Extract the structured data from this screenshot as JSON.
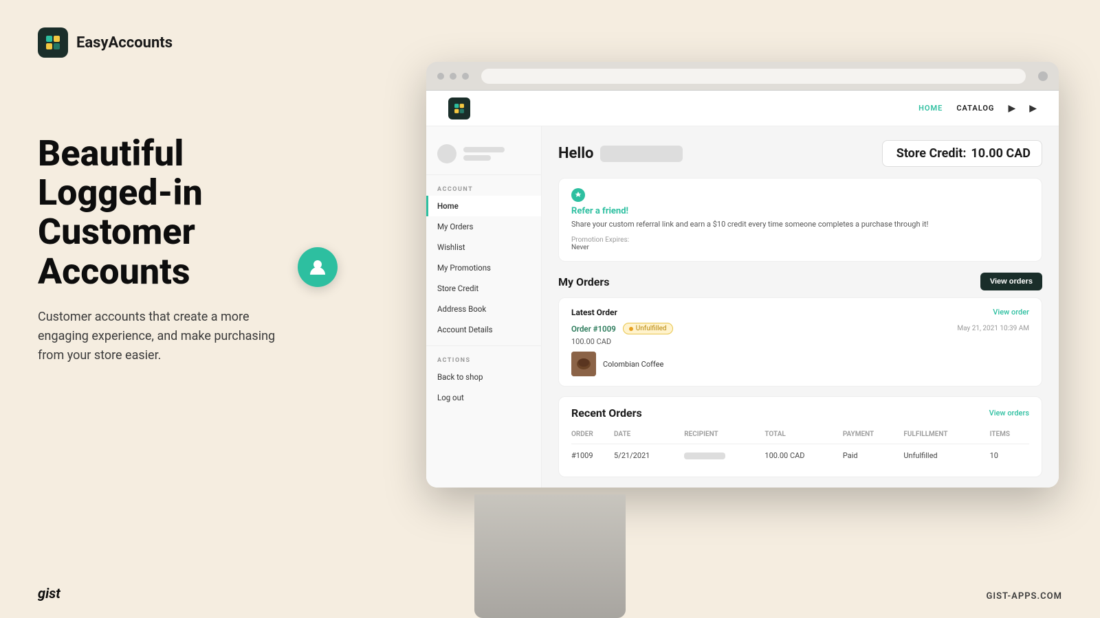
{
  "brand": {
    "name": "EasyAccounts",
    "logo_alt": "EasyAccounts logo icon"
  },
  "hero": {
    "title": "Beautiful\nLogged-in\nCustomer\nAccounts",
    "subtitle": "Customer accounts that create a more engaging experience, and make purchasing from your store easier."
  },
  "footer": {
    "left": "gist",
    "right": "GIST-APPS.COM"
  },
  "store": {
    "nav": {
      "items": [
        "HOME",
        "CATALOG"
      ],
      "icons": [
        "user-icon",
        "cart-icon"
      ]
    },
    "header": {
      "hello": "Hello",
      "store_credit_label": "Store Credit:",
      "store_credit_value": "10.00 CAD"
    },
    "sidebar": {
      "account_section": "ACCOUNT",
      "actions_section": "ACTIONS",
      "nav_items": [
        {
          "label": "Home",
          "active": true
        },
        {
          "label": "My Orders",
          "active": false
        },
        {
          "label": "Wishlist",
          "active": false
        },
        {
          "label": "My Promotions",
          "active": false
        },
        {
          "label": "Store Credit",
          "active": false
        },
        {
          "label": "Address Book",
          "active": false
        },
        {
          "label": "Account Details",
          "active": false
        }
      ],
      "action_items": [
        {
          "label": "Back to shop",
          "active": false
        },
        {
          "label": "Log out",
          "active": false
        }
      ]
    },
    "referral": {
      "title": "Refer a friend!",
      "description": "Share your custom referral link and earn a $10 credit every time someone completes a purchase through it!",
      "expires_label": "Promotion Expires:",
      "expires_value": "Never"
    },
    "my_orders": {
      "title": "My Orders",
      "view_orders_btn": "View orders",
      "latest_order": {
        "section_title": "Latest Order",
        "view_link": "View order",
        "order_number": "Order #1009",
        "status": "Unfulfilled",
        "date": "May 21, 2021 10:39 AM",
        "amount": "100.00 CAD",
        "product_name": "Colombian Coffee"
      },
      "recent_orders": {
        "title": "Recent Orders",
        "view_link": "View orders",
        "columns": [
          "ORDER",
          "DATE",
          "RECIPIENT",
          "TOTAL",
          "PAYMENT",
          "FULFILLMENT",
          "ITEMS"
        ],
        "rows": [
          {
            "order": "#1009",
            "date": "5/21/2021",
            "recipient": "",
            "total": "100.00 CAD",
            "payment": "Paid",
            "fulfillment": "Unfulfilled",
            "items": "10"
          }
        ]
      }
    }
  }
}
